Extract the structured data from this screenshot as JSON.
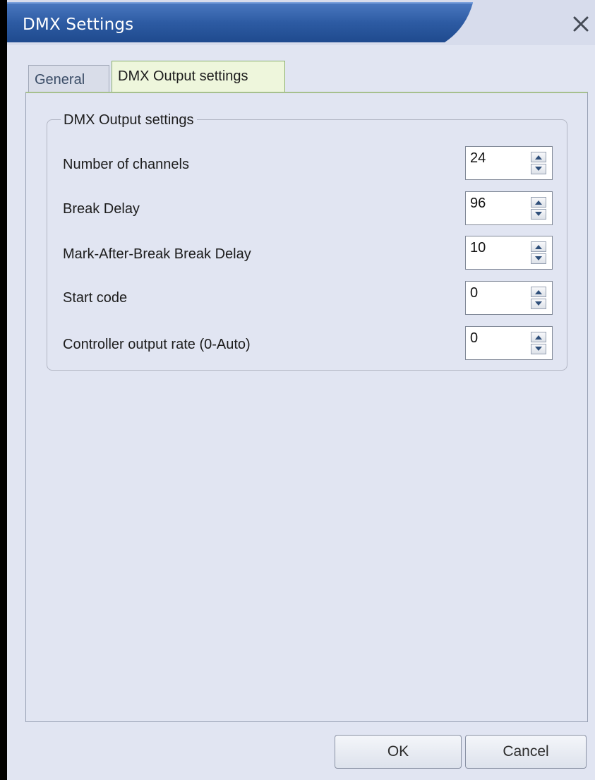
{
  "window": {
    "title": "DMX Settings",
    "close_label": "✕"
  },
  "tabs": [
    {
      "label": "General",
      "active": false
    },
    {
      "label": "DMX Output settings",
      "active": true
    }
  ],
  "group": {
    "legend": "DMX Output settings",
    "fields": [
      {
        "label": "Number of channels",
        "value": "24"
      },
      {
        "label": "Break Delay",
        "value": "96"
      },
      {
        "label": "Mark-After-Break Break Delay",
        "value": "10"
      },
      {
        "label": "Start code",
        "value": "0"
      },
      {
        "label": "Controller output rate (0-Auto)",
        "value": "0"
      }
    ]
  },
  "buttons": {
    "ok": "OK",
    "cancel": "Cancel"
  },
  "colors": {
    "titlebar_accent": "#2f5a9c",
    "active_tab": "#eef6dc",
    "background": "#e1e5f2"
  }
}
